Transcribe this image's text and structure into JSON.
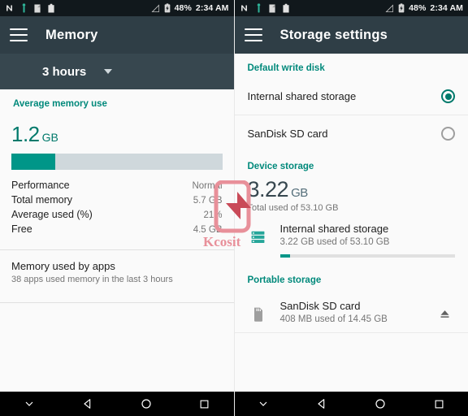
{
  "status_bar": {
    "icons_left": [
      "nfc-n-icon",
      "android-usb-icon",
      "clipboard-icon",
      "clipboard-filled-icon"
    ],
    "icons_right": [
      "signal-off-icon",
      "battery-charging-icon"
    ],
    "battery": "48%",
    "time": "2:34 AM"
  },
  "left_panel": {
    "toolbar": {
      "menu_icon": "hamburger-menu-icon",
      "title": "Memory"
    },
    "spinner": {
      "value": "3 hours",
      "caret_icon": "chevron-down-icon"
    },
    "section_title": "Average memory use",
    "big_value": "1.2",
    "big_unit": "GB",
    "usage_percent": 21,
    "stats": [
      {
        "key": "Performance",
        "value": "Normal"
      },
      {
        "key": "Total memory",
        "value": "5.7 GB"
      },
      {
        "key": "Average used (%)",
        "value": "21%"
      },
      {
        "key": "Free",
        "value": "4.5 GB"
      }
    ],
    "apps_item": {
      "title": "Memory used by apps",
      "subtitle": "38 apps used memory in the last 3 hours"
    }
  },
  "right_panel": {
    "toolbar": {
      "menu_icon": "hamburger-menu-icon",
      "title": "Storage settings"
    },
    "default_write_disk": {
      "section_title": "Default write disk",
      "options": [
        {
          "label": "Internal shared storage",
          "selected": true
        },
        {
          "label": "SanDisk SD card",
          "selected": false
        }
      ]
    },
    "device_storage": {
      "section_title": "Device storage",
      "big_value": "3.22",
      "big_unit": "GB",
      "subtitle": "Total used of 53.10 GB",
      "item": {
        "icon": "storage-server-icon",
        "title": "Internal shared storage",
        "subtitle": "3.22 GB used of 53.10 GB",
        "used_percent": 6
      }
    },
    "portable_storage": {
      "section_title": "Portable storage",
      "item": {
        "icon": "sd-card-icon",
        "title": "SanDisk SD card",
        "subtitle": "408 MB used of 14.45 GB",
        "eject_icon": "eject-icon"
      }
    }
  },
  "nav_bar": {
    "buttons": [
      "hide-keyboard-icon",
      "back-icon",
      "home-icon",
      "recents-icon"
    ]
  },
  "watermark": {
    "text": "Kcosit",
    "logo_icon": "kcosit-device-logo"
  },
  "colors": {
    "accent_teal": "#009688",
    "accent_teal_dark": "#00796B",
    "toolbar": "#2F3E46",
    "spinner_bar": "#37474F",
    "status_bar": "#11181C",
    "watermark": "#E8909A"
  }
}
